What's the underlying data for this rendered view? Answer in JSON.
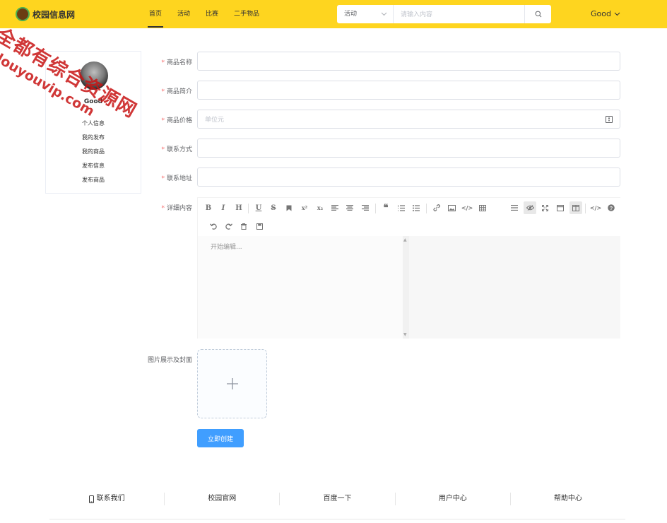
{
  "header": {
    "logo_text": "校园信息网",
    "nav": [
      "首页",
      "活动",
      "比赛",
      "二手物品"
    ],
    "search": {
      "category": "活动",
      "placeholder": "请输入内容"
    },
    "user": "Good"
  },
  "sidebar": {
    "name": "Good",
    "items": [
      "个人信息",
      "我的发布",
      "我的商品",
      "发布信息",
      "发布商品"
    ]
  },
  "form": {
    "fields": [
      {
        "label": "商品名称",
        "required": true,
        "placeholder": ""
      },
      {
        "label": "商品简介",
        "required": true,
        "placeholder": ""
      },
      {
        "label": "商品价格",
        "required": true,
        "placeholder": "单位元"
      },
      {
        "label": "联系方式",
        "required": true,
        "placeholder": ""
      },
      {
        "label": "联系地址",
        "required": true,
        "placeholder": ""
      }
    ],
    "detail_label": "详细内容",
    "editor_placeholder": "开始编辑...",
    "upload_label": "图片展示及封面",
    "submit": "立即创建"
  },
  "editor_toolbar": [
    "bold-icon",
    "italic-icon",
    "heading-icon",
    "underline-icon",
    "strikethrough-icon",
    "mark-icon",
    "superscript-icon",
    "subscript-icon",
    "align-left-icon",
    "align-center-icon",
    "align-right-icon",
    "quote-icon",
    "ordered-list-icon",
    "unordered-list-icon",
    "link-icon",
    "image-icon",
    "code-icon",
    "table-icon",
    "navigation-icon",
    "preview-toggle-icon",
    "fullscreen-icon",
    "read-mode-icon",
    "subfield-icon",
    "html-icon",
    "help-icon",
    "undo-icon",
    "redo-icon",
    "trash-icon",
    "save-icon"
  ],
  "footer": [
    "联系我们",
    "校园官网",
    "百度一下",
    "用户中心",
    "帮助中心"
  ],
  "watermark": {
    "line1": "全都有综合资源网",
    "line2": "douyouvip.com"
  },
  "colors": {
    "header_bg": "#fed51f",
    "primary": "#409eff",
    "required": "#f56c6c"
  }
}
